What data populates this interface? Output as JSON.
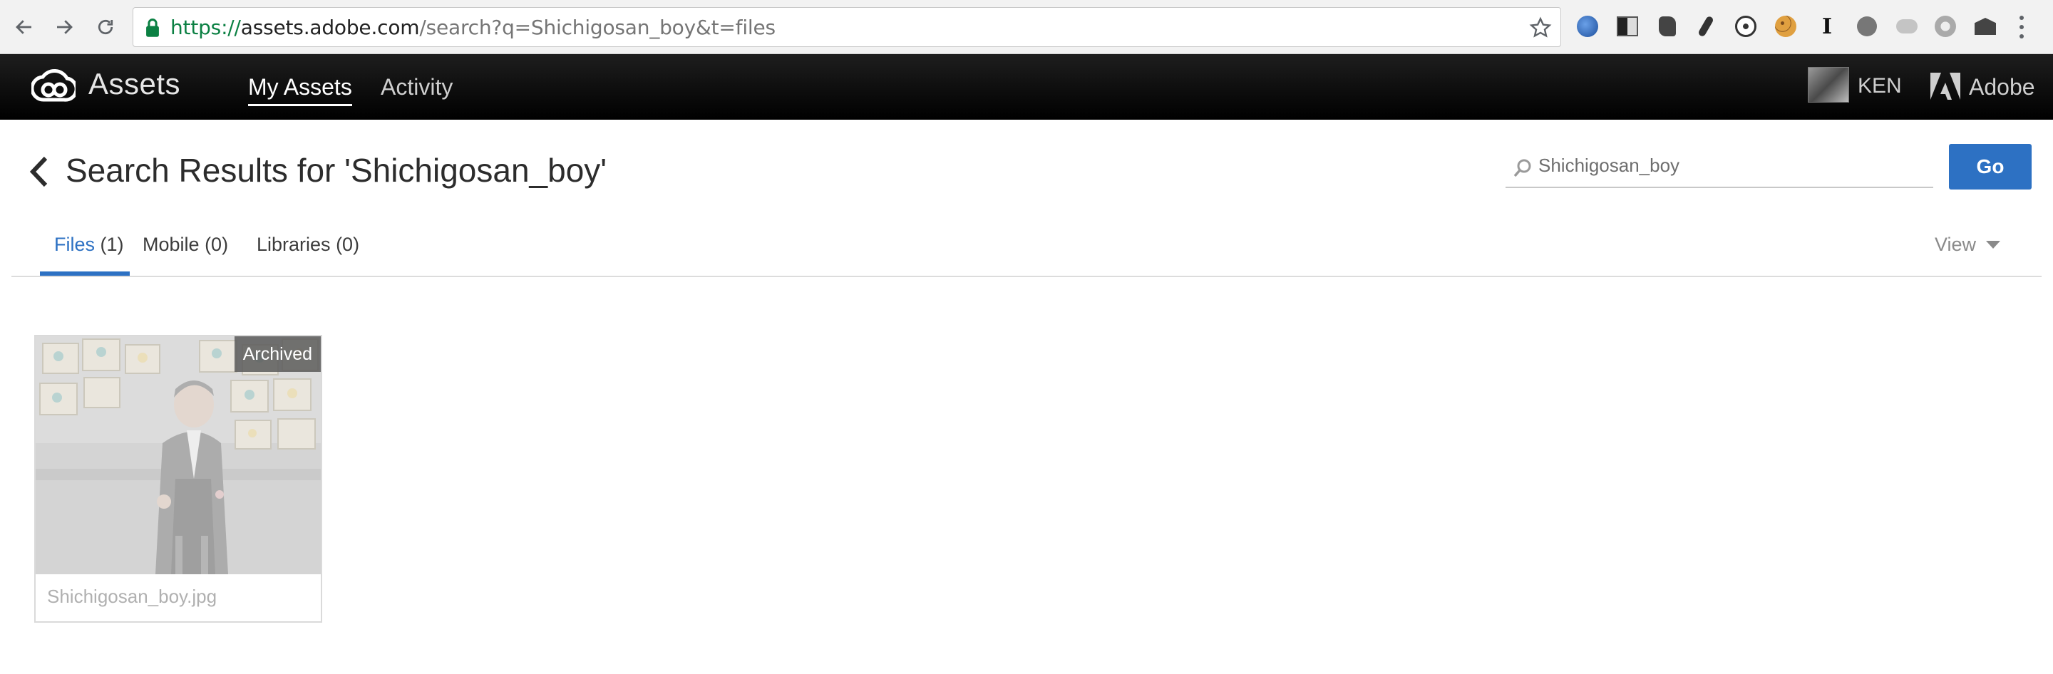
{
  "browser": {
    "url_scheme": "https://",
    "url_host": "assets.adobe.com",
    "url_path": "/search?q=Shichigosan_boy&t=files",
    "extension_icon_text": "I"
  },
  "header": {
    "app_title": "Assets",
    "nav": [
      {
        "label": "My Assets",
        "active": true
      },
      {
        "label": "Activity",
        "active": false
      }
    ],
    "user_name": "KEN",
    "adobe_label": "Adobe"
  },
  "search": {
    "title": "Search Results for 'Shichigosan_boy'",
    "query": "Shichigosan_boy",
    "go_label": "Go"
  },
  "tabs": [
    {
      "label": "Files",
      "count": "(1)",
      "active": true
    },
    {
      "label": "Mobile",
      "count": "(0)",
      "active": false
    },
    {
      "label": "Libraries",
      "count": "(0)",
      "active": false
    }
  ],
  "view_label": "View",
  "assets": [
    {
      "name": "Shichigosan_boy.jpg",
      "badge": "Archived"
    }
  ],
  "colors": {
    "accent": "#2d71c3",
    "appbar": "#111111",
    "secure": "#0b8043"
  }
}
